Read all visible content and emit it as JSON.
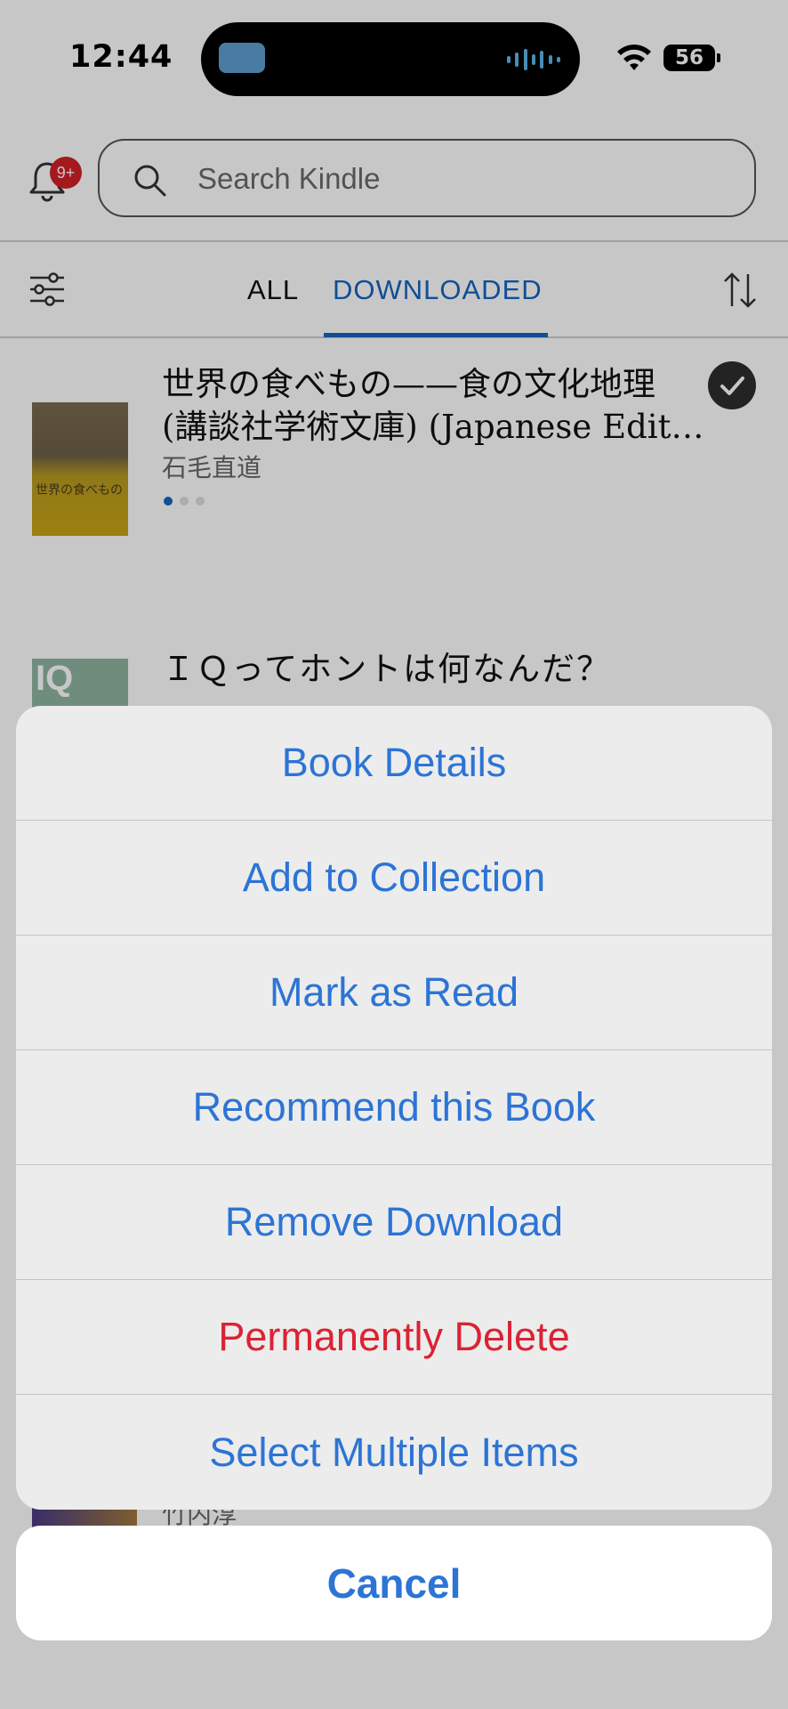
{
  "status_bar": {
    "time": "12:44",
    "battery": "56"
  },
  "header": {
    "notification_badge": "9+",
    "search": {
      "placeholder": "Search Kindle"
    }
  },
  "tabs": {
    "all": "ALL",
    "downloaded": "DOWNLOADED",
    "active": "DOWNLOADED"
  },
  "books": [
    {
      "title_line1": "世界の食べもの——食の文化地理",
      "title_line2": "(講談社学術文庫) (Japanese Edit…",
      "author": "石毛直道",
      "cover_text": "世界の食べもの",
      "selected": true
    },
    {
      "title_line1": "ＩＱってホントは何なんだ？",
      "cover_text": "IQ"
    },
    {
      "author": "竹内淳"
    }
  ],
  "action_sheet": {
    "items": [
      {
        "label": "Book Details",
        "style": "default"
      },
      {
        "label": "Add to Collection",
        "style": "default"
      },
      {
        "label": "Mark as Read",
        "style": "default"
      },
      {
        "label": "Recommend this Book",
        "style": "default"
      },
      {
        "label": "Remove Download",
        "style": "default"
      },
      {
        "label": "Permanently Delete",
        "style": "destructive"
      },
      {
        "label": "Select Multiple Items",
        "style": "default"
      }
    ],
    "cancel_label": "Cancel"
  },
  "colors": {
    "accent": "#2c74d6",
    "tab_active": "#1565c0",
    "destructive": "#dc2233",
    "badge": "#d32027"
  },
  "icons": {
    "bell": "bell-icon",
    "search": "search-icon",
    "filter": "filter-icon",
    "sort": "sort-icon",
    "check": "check-icon",
    "wifi": "wifi-icon",
    "battery": "battery-icon"
  }
}
